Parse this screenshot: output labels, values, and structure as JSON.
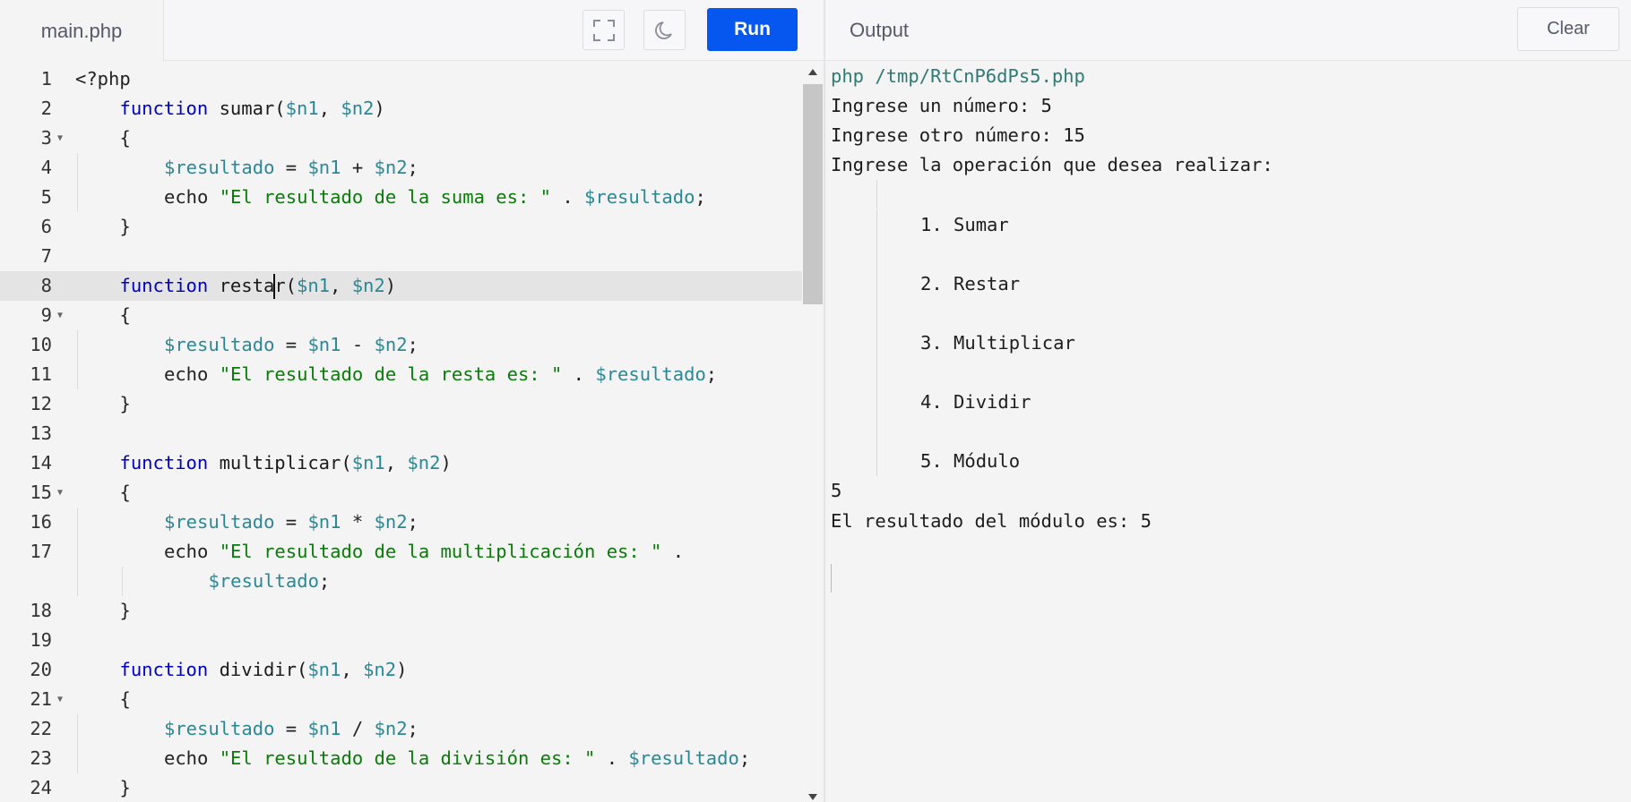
{
  "editor": {
    "tab_label": "main.php",
    "run_label": "Run",
    "lines": [
      {
        "n": "1",
        "indent": 0,
        "fold": false,
        "tokens": [
          {
            "t": "plain",
            "v": "<?php"
          }
        ]
      },
      {
        "n": "2",
        "indent": 1,
        "fold": false,
        "tokens": [
          {
            "t": "kw",
            "v": "function"
          },
          {
            "t": "fn",
            "v": " sumar("
          },
          {
            "t": "var",
            "v": "$n1"
          },
          {
            "t": "plain",
            "v": ", "
          },
          {
            "t": "var",
            "v": "$n2"
          },
          {
            "t": "plain",
            "v": ")"
          }
        ]
      },
      {
        "n": "3",
        "indent": 1,
        "fold": true,
        "tokens": [
          {
            "t": "plain",
            "v": "{"
          }
        ]
      },
      {
        "n": "4",
        "indent": 2,
        "fold": false,
        "tokens": [
          {
            "t": "var",
            "v": "$resultado"
          },
          {
            "t": "plain",
            "v": " = "
          },
          {
            "t": "var",
            "v": "$n1"
          },
          {
            "t": "plain",
            "v": " + "
          },
          {
            "t": "var",
            "v": "$n2"
          },
          {
            "t": "plain",
            "v": ";"
          }
        ]
      },
      {
        "n": "5",
        "indent": 2,
        "fold": false,
        "tokens": [
          {
            "t": "plain",
            "v": "echo "
          },
          {
            "t": "str",
            "v": "\"El resultado de la suma es: \""
          },
          {
            "t": "plain",
            "v": " . "
          },
          {
            "t": "var",
            "v": "$resultado"
          },
          {
            "t": "plain",
            "v": ";"
          }
        ]
      },
      {
        "n": "6",
        "indent": 1,
        "fold": false,
        "tokens": [
          {
            "t": "plain",
            "v": "}"
          }
        ]
      },
      {
        "n": "7",
        "indent": 0,
        "fold": false,
        "tokens": []
      },
      {
        "n": "8",
        "indent": 1,
        "fold": false,
        "active": true,
        "tokens": [
          {
            "t": "kw",
            "v": "function"
          },
          {
            "t": "fn",
            "v": " resta"
          },
          {
            "t": "caret",
            "v": ""
          },
          {
            "t": "fn",
            "v": "r("
          },
          {
            "t": "var",
            "v": "$n1"
          },
          {
            "t": "plain",
            "v": ", "
          },
          {
            "t": "var",
            "v": "$n2"
          },
          {
            "t": "plain",
            "v": ")"
          }
        ]
      },
      {
        "n": "9",
        "indent": 1,
        "fold": true,
        "tokens": [
          {
            "t": "plain",
            "v": "{"
          }
        ]
      },
      {
        "n": "10",
        "indent": 2,
        "fold": false,
        "tokens": [
          {
            "t": "var",
            "v": "$resultado"
          },
          {
            "t": "plain",
            "v": " = "
          },
          {
            "t": "var",
            "v": "$n1"
          },
          {
            "t": "plain",
            "v": " - "
          },
          {
            "t": "var",
            "v": "$n2"
          },
          {
            "t": "plain",
            "v": ";"
          }
        ]
      },
      {
        "n": "11",
        "indent": 2,
        "fold": false,
        "tokens": [
          {
            "t": "plain",
            "v": "echo "
          },
          {
            "t": "str",
            "v": "\"El resultado de la resta es: \""
          },
          {
            "t": "plain",
            "v": " . "
          },
          {
            "t": "var",
            "v": "$resultado"
          },
          {
            "t": "plain",
            "v": ";"
          }
        ]
      },
      {
        "n": "12",
        "indent": 1,
        "fold": false,
        "tokens": [
          {
            "t": "plain",
            "v": "}"
          }
        ]
      },
      {
        "n": "13",
        "indent": 0,
        "fold": false,
        "tokens": []
      },
      {
        "n": "14",
        "indent": 1,
        "fold": false,
        "tokens": [
          {
            "t": "kw",
            "v": "function"
          },
          {
            "t": "fn",
            "v": " multiplicar("
          },
          {
            "t": "var",
            "v": "$n1"
          },
          {
            "t": "plain",
            "v": ", "
          },
          {
            "t": "var",
            "v": "$n2"
          },
          {
            "t": "plain",
            "v": ")"
          }
        ]
      },
      {
        "n": "15",
        "indent": 1,
        "fold": true,
        "tokens": [
          {
            "t": "plain",
            "v": "{"
          }
        ]
      },
      {
        "n": "16",
        "indent": 2,
        "fold": false,
        "tokens": [
          {
            "t": "var",
            "v": "$resultado"
          },
          {
            "t": "plain",
            "v": " = "
          },
          {
            "t": "var",
            "v": "$n1"
          },
          {
            "t": "plain",
            "v": " * "
          },
          {
            "t": "var",
            "v": "$n2"
          },
          {
            "t": "plain",
            "v": ";"
          }
        ]
      },
      {
        "n": "17",
        "indent": 2,
        "fold": false,
        "tokens": [
          {
            "t": "plain",
            "v": "echo "
          },
          {
            "t": "str",
            "v": "\"El resultado de la multiplicación es: \""
          },
          {
            "t": "plain",
            "v": " ."
          }
        ]
      },
      {
        "n": "",
        "indent": 3,
        "fold": false,
        "wrap": true,
        "tokens": [
          {
            "t": "var",
            "v": "$resultado"
          },
          {
            "t": "plain",
            "v": ";"
          }
        ]
      },
      {
        "n": "18",
        "indent": 1,
        "fold": false,
        "tokens": [
          {
            "t": "plain",
            "v": "}"
          }
        ]
      },
      {
        "n": "19",
        "indent": 0,
        "fold": false,
        "tokens": []
      },
      {
        "n": "20",
        "indent": 1,
        "fold": false,
        "tokens": [
          {
            "t": "kw",
            "v": "function"
          },
          {
            "t": "fn",
            "v": " dividir("
          },
          {
            "t": "var",
            "v": "$n1"
          },
          {
            "t": "plain",
            "v": ", "
          },
          {
            "t": "var",
            "v": "$n2"
          },
          {
            "t": "plain",
            "v": ")"
          }
        ]
      },
      {
        "n": "21",
        "indent": 1,
        "fold": true,
        "tokens": [
          {
            "t": "plain",
            "v": "{"
          }
        ]
      },
      {
        "n": "22",
        "indent": 2,
        "fold": false,
        "tokens": [
          {
            "t": "var",
            "v": "$resultado"
          },
          {
            "t": "plain",
            "v": " = "
          },
          {
            "t": "var",
            "v": "$n1"
          },
          {
            "t": "plain",
            "v": " / "
          },
          {
            "t": "var",
            "v": "$n2"
          },
          {
            "t": "plain",
            "v": ";"
          }
        ]
      },
      {
        "n": "23",
        "indent": 2,
        "fold": false,
        "tokens": [
          {
            "t": "plain",
            "v": "echo "
          },
          {
            "t": "str",
            "v": "\"El resultado de la división es: \""
          },
          {
            "t": "plain",
            "v": " . "
          },
          {
            "t": "var",
            "v": "$resultado"
          },
          {
            "t": "plain",
            "v": ";"
          }
        ]
      },
      {
        "n": "24",
        "indent": 1,
        "fold": false,
        "tokens": [
          {
            "t": "plain",
            "v": "}"
          }
        ]
      }
    ]
  },
  "output": {
    "title": "Output",
    "clear_label": "Clear",
    "lines": [
      {
        "text": "php /tmp/RtCnP6dPs5.php",
        "kind": "cmd"
      },
      {
        "text": "Ingrese un número: 5",
        "kind": "plain"
      },
      {
        "text": "Ingrese otro número: 15",
        "kind": "plain"
      },
      {
        "text": "Ingrese la operación que desea realizar:",
        "kind": "plain"
      },
      {
        "text": "",
        "kind": "blank"
      },
      {
        "text": "1. Sumar",
        "kind": "menu"
      },
      {
        "text": "",
        "kind": "blank"
      },
      {
        "text": "2. Restar",
        "kind": "menu"
      },
      {
        "text": "",
        "kind": "blank"
      },
      {
        "text": "3. Multiplicar",
        "kind": "menu"
      },
      {
        "text": "",
        "kind": "blank"
      },
      {
        "text": "4. Dividir",
        "kind": "menu"
      },
      {
        "text": "",
        "kind": "blank"
      },
      {
        "text": "5. Módulo",
        "kind": "menu"
      },
      {
        "text": "5",
        "kind": "plain"
      },
      {
        "text": "El resultado del módulo es: 5",
        "kind": "plain"
      }
    ]
  },
  "colors": {
    "run_button": "#0557f0",
    "keyword": "#0000cc",
    "variable": "#2a8896",
    "string": "#0b7a0b",
    "output_command": "#2e7b76"
  },
  "icons": {
    "fullscreen": "fullscreen-icon",
    "theme": "moon-icon",
    "fold": "fold-arrow-icon"
  }
}
